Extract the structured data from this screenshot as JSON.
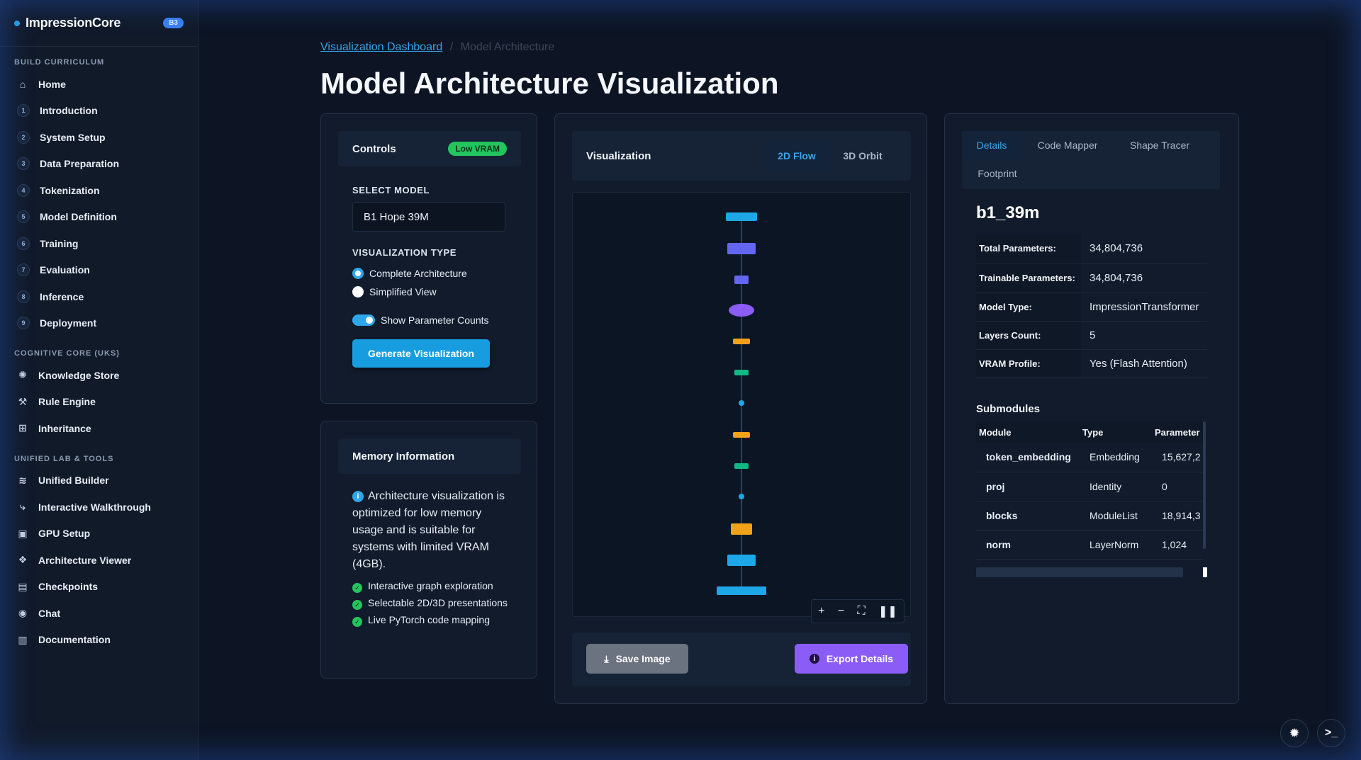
{
  "brand": {
    "name": "ImpressionCore",
    "badge": "B3"
  },
  "sidebar": {
    "sections": [
      {
        "title": "BUILD CURRICULUM"
      },
      {
        "title": "COGNITIVE CORE (UKS)"
      },
      {
        "title": "UNIFIED LAB & TOOLS"
      }
    ],
    "curriculum": [
      {
        "label": "Home",
        "icon": "home-icon"
      },
      {
        "num": "1",
        "label": "Introduction"
      },
      {
        "num": "2",
        "label": "System Setup"
      },
      {
        "num": "3",
        "label": "Data Preparation"
      },
      {
        "num": "4",
        "label": "Tokenization"
      },
      {
        "num": "5",
        "label": "Model Definition"
      },
      {
        "num": "6",
        "label": "Training"
      },
      {
        "num": "7",
        "label": "Evaluation"
      },
      {
        "num": "8",
        "label": "Inference"
      },
      {
        "num": "9",
        "label": "Deployment"
      }
    ],
    "core": [
      {
        "label": "Knowledge Store",
        "icon": "brain-icon"
      },
      {
        "label": "Rule Engine",
        "icon": "gavel-icon"
      },
      {
        "label": "Inheritance",
        "icon": "sitemap-icon"
      }
    ],
    "tools": [
      {
        "label": "Unified Builder",
        "icon": "layers-icon"
      },
      {
        "label": "Interactive Walkthrough",
        "icon": "route-icon"
      },
      {
        "label": "GPU Setup",
        "icon": "chip-icon"
      },
      {
        "label": "Architecture Viewer",
        "icon": "cubes-icon"
      },
      {
        "label": "Checkpoints",
        "icon": "save-icon"
      },
      {
        "label": "Chat",
        "icon": "chat-icon"
      },
      {
        "label": "Documentation",
        "icon": "book-icon"
      }
    ]
  },
  "breadcrumb": {
    "link": "Visualization Dashboard",
    "separator": "/",
    "current": "Model Architecture"
  },
  "page_title": "Model Architecture Visualization",
  "controls": {
    "title": "Controls",
    "badge": "Low VRAM",
    "select_model_label": "SELECT MODEL",
    "model_value": "B1 Hope 39M",
    "viz_type_label": "VISUALIZATION TYPE",
    "radio_complete": "Complete Architecture",
    "radio_simplified": "Simplified View",
    "toggle_label": "Show Parameter Counts",
    "generate_button": "Generate Visualization"
  },
  "memory": {
    "title": "Memory Information",
    "info_text": "Architecture visualization is optimized for low memory usage and is suitable for systems with limited VRAM (4GB).",
    "features": [
      "Interactive graph exploration",
      "Selectable 2D/3D presentations",
      "Live PyTorch code mapping"
    ]
  },
  "visualization": {
    "title": "Visualization",
    "tab_2d": "2D Flow",
    "tab_3d": "3D Orbit",
    "save_button": "Save Image",
    "export_button": "Export Details",
    "colors": {
      "blue": "#1ea7e6",
      "indigo": "#6366f1",
      "violet": "#8b5cf6",
      "amber": "#f0a21b",
      "green": "#10b981"
    }
  },
  "details": {
    "tabs": [
      "Details",
      "Code Mapper",
      "Shape Tracer",
      "Footprint"
    ],
    "model_name": "b1_39m",
    "rows": [
      {
        "key": "Total Parameters:",
        "value": "34,804,736"
      },
      {
        "key": "Trainable Parameters:",
        "value": "34,804,736"
      },
      {
        "key": "Model Type:",
        "value": "ImpressionTransformer"
      },
      {
        "key": "Layers Count:",
        "value": "5"
      },
      {
        "key": "VRAM Profile:",
        "value": "Yes (Flash Attention)"
      }
    ],
    "submodules_title": "Submodules",
    "columns": [
      "Module",
      "Type",
      "Parameter"
    ],
    "submodules": [
      {
        "module": "token_embedding",
        "type": "Embedding",
        "params": "15,627,2"
      },
      {
        "module": "proj",
        "type": "Identity",
        "params": "0"
      },
      {
        "module": "blocks",
        "type": "ModuleList",
        "params": "18,914,3"
      },
      {
        "module": "norm",
        "type": "LayerNorm",
        "params": "1,024"
      }
    ]
  }
}
